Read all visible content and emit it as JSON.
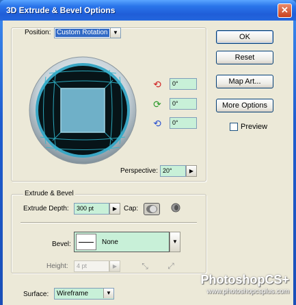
{
  "window": {
    "title": "3D Extrude & Bevel Options",
    "close_glyph": "✕"
  },
  "position": {
    "label": "Position:",
    "value": "Custom Rotation",
    "x_angle": "0°",
    "y_angle": "0°",
    "z_angle": "0°",
    "perspective_label": "Perspective:",
    "perspective_value": "20°"
  },
  "buttons": {
    "ok": "OK",
    "reset": "Reset",
    "map_art": "Map Art...",
    "more_options": "More Options",
    "preview": "Preview",
    "preview_checked": false
  },
  "extrude_bevel": {
    "group_label": "Extrude & Bevel",
    "depth_label": "Extrude Depth:",
    "depth_value": "300 pt",
    "cap_label": "Cap:",
    "bevel_label": "Bevel:",
    "bevel_value": "None",
    "height_label": "Height:",
    "height_value": "4 pt"
  },
  "surface": {
    "label": "Surface:",
    "value": "Wireframe"
  },
  "watermark": {
    "brand": "PhotoshopCS+",
    "url": "www.photoshopcsplus.com"
  },
  "colors": {
    "field_fill": "#c8f0d8",
    "selection": "#316ac5",
    "track_cyan": "#3fc6d8"
  },
  "icons": [
    "x-axis-rotate-icon",
    "y-axis-rotate-icon",
    "z-axis-rotate-icon",
    "cap-on-icon",
    "cap-off-icon",
    "bevel-extent-in-icon",
    "bevel-extent-out-icon"
  ]
}
